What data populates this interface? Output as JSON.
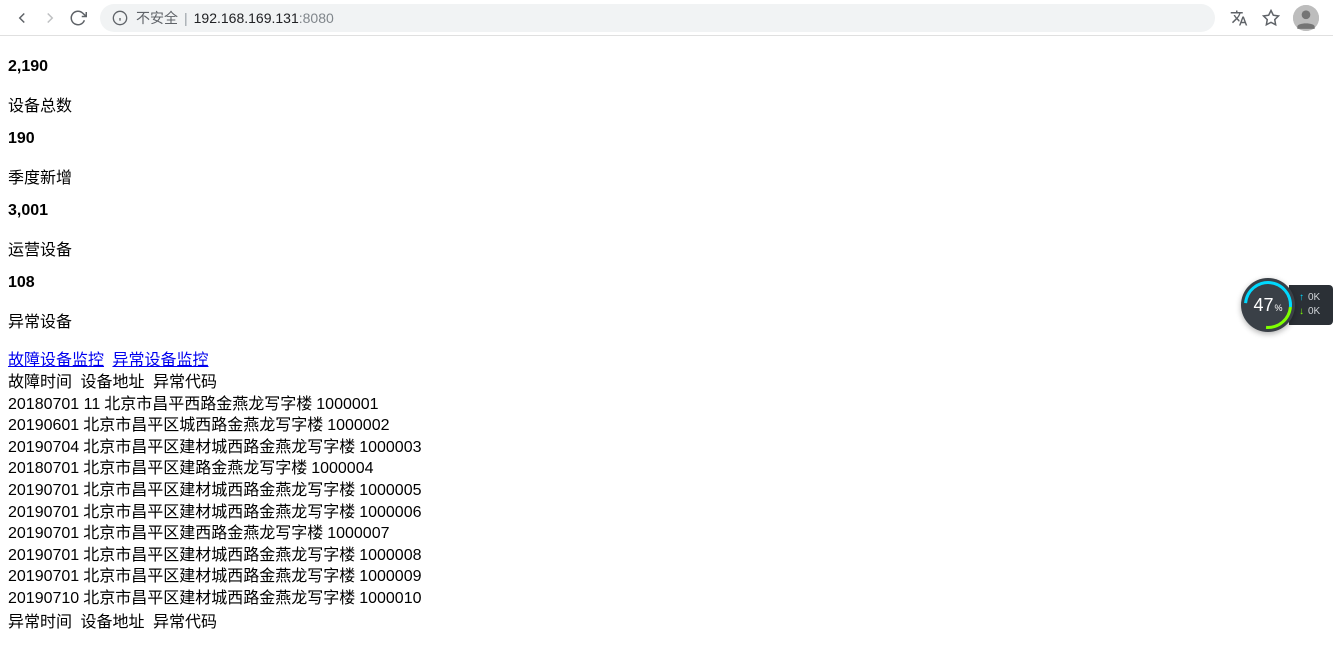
{
  "browser": {
    "security_label": "不安全",
    "address_host": "192.168.169.131",
    "address_port": ":8080"
  },
  "stats": [
    {
      "value": "2,190",
      "label": "设备总数"
    },
    {
      "value": "190",
      "label": "季度新增"
    },
    {
      "value": "3,001",
      "label": "运营设备"
    },
    {
      "value": "108",
      "label": "异常设备"
    }
  ],
  "links": {
    "fault_monitor": "故障设备监控",
    "abnormal_monitor": "异常设备监控"
  },
  "fault_table": {
    "headers": {
      "time": "故障时间",
      "address": "设备地址",
      "code": "异常代码"
    },
    "rows": [
      {
        "time": "20180701 11",
        "address": "北京市昌平西路金燕龙写字楼",
        "code": "1000001"
      },
      {
        "time": "20190601",
        "address": "北京市昌平区城西路金燕龙写字楼",
        "code": "1000002"
      },
      {
        "time": "20190704",
        "address": "北京市昌平区建材城西路金燕龙写字楼",
        "code": "1000003"
      },
      {
        "time": "20180701",
        "address": "北京市昌平区建路金燕龙写字楼",
        "code": "1000004"
      },
      {
        "time": "20190701",
        "address": "北京市昌平区建材城西路金燕龙写字楼",
        "code": "1000005"
      },
      {
        "time": "20190701",
        "address": "北京市昌平区建材城西路金燕龙写字楼",
        "code": "1000006"
      },
      {
        "time": "20190701",
        "address": "北京市昌平区建西路金燕龙写字楼",
        "code": "1000007"
      },
      {
        "time": "20190701",
        "address": "北京市昌平区建材城西路金燕龙写字楼",
        "code": "1000008"
      },
      {
        "time": "20190701",
        "address": "北京市昌平区建材城西路金燕龙写字楼",
        "code": "1000009"
      },
      {
        "time": "20190710",
        "address": "北京市昌平区建材城西路金燕龙写字楼",
        "code": "1000010"
      }
    ]
  },
  "abnormal_table": {
    "headers": {
      "time": "异常时间",
      "address": "设备地址",
      "code": "异常代码"
    }
  },
  "widget": {
    "percent": "47",
    "unit": "%",
    "up": "0K",
    "down": "0K"
  }
}
